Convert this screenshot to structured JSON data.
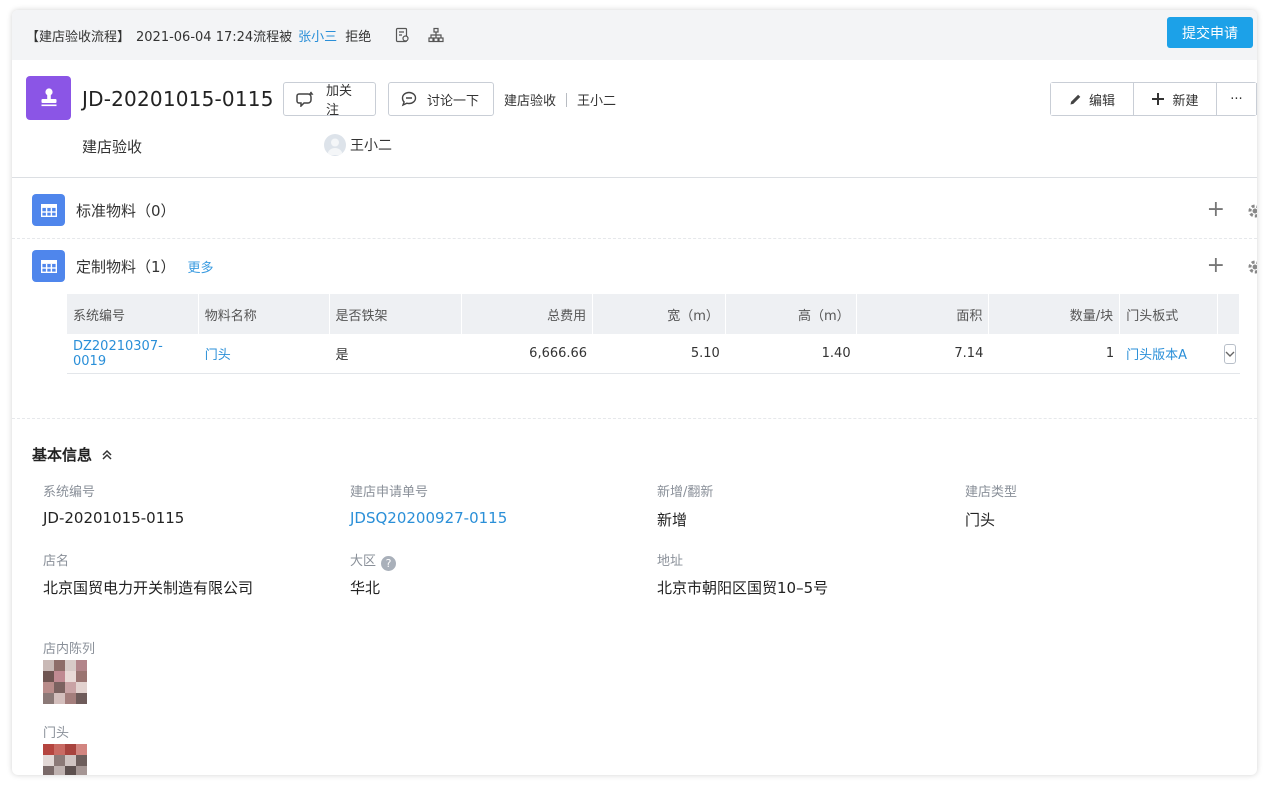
{
  "topbar": {
    "process": "【建店验收流程】",
    "datetime": "2021-06-04 17:24流程被",
    "user": "张小三",
    "action": "拒绝",
    "submit_label": "提交申请"
  },
  "header": {
    "doc_number": "JD-20201015-0115",
    "follow_label": "加关注",
    "discuss_label": "讨论一下",
    "crumb_type": "建店验收",
    "crumb_owner": "王小二",
    "subtitle": "建店验收",
    "owner_name": "王小二",
    "edit_label": "编辑",
    "new_label": "新建",
    "more_label": "···",
    "accent_color": "#8b55e6"
  },
  "sections": {
    "standard": {
      "title": "标准物料（0）"
    },
    "custom": {
      "title": "定制物料（1）",
      "more_label": "更多"
    }
  },
  "table": {
    "columns": [
      "系统编号",
      "物料名称",
      "是否铁架",
      "总费用",
      "宽（m）",
      "高（m）",
      "面积",
      "数量/块",
      "门头板式"
    ],
    "rows": [
      [
        "DZ20210307-0019",
        "门头",
        "是",
        "6,666.66",
        "5.10",
        "1.40",
        "7.14",
        "1",
        "门头版本A"
      ]
    ]
  },
  "basic_info": {
    "title": "基本信息",
    "fields": [
      {
        "label": "系统编号",
        "value": "JD-20201015-0115"
      },
      {
        "label": "建店申请单号",
        "value": "JDSQ20200927-0115"
      },
      {
        "label": "新增/翻新",
        "value": "新增"
      },
      {
        "label": "建店类型",
        "value": "门头"
      },
      {
        "label": "店名",
        "value": "北京国贸电力开关制造有限公司"
      },
      {
        "label": "大区",
        "value": "华北"
      },
      {
        "label": "地址",
        "value": "北京市朝阳区国贸10–5号"
      }
    ],
    "image_labels": [
      "店内陈列",
      "门头"
    ]
  }
}
